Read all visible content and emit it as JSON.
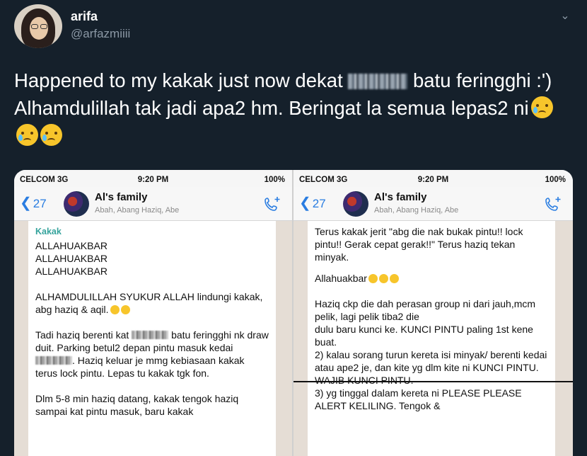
{
  "tweet": {
    "name": "arifa",
    "handle": "@arfazmiiii",
    "text_1": "Happened to my kakak just now dekat ",
    "text_2": " batu feringghi :') Alhamdulillah tak jadi apa2 hm. Beringat la semua lepas2 ni",
    "emoji_count": 3,
    "emoji_icon": "crying-face-icon"
  },
  "phone": {
    "carrier": "CELCOM  3G",
    "time": "9:20 PM",
    "battery": "100%",
    "back_count": "27",
    "group_name": "Al's family",
    "members": "Abah, Abang Haziq, Abe"
  },
  "chat_left": {
    "sender": "Kakak",
    "l1": "ALLAHUAKBAR\nALLAHUAKBAR\nALLAHUAKBAR",
    "l2": "ALHAMDULILLAH SYUKUR ALLAH lindungi kakak, abg haziq & aqil.",
    "l3a": "Tadi haziq berenti kat ",
    "l3b": " batu feringghi nk draw duit. Parking betul2 depan pintu masuk kedai ",
    "l3c": ". Haziq keluar je mmg kebiasaan kakak terus lock pintu. Lepas tu kakak tgk fon.",
    "l4": "Dlm 5-8 min haziq datang, kakak tengok haziq sampai kat pintu masuk, baru kakak"
  },
  "chat_right": {
    "l1": "Terus kakak jerit \"abg die nak bukak pintu!! lock pintu!! Gerak cepat gerak!!\" Terus haziq tekan minyak.",
    "l2": "Allahuakbar",
    "l3": "Haziq ckp die dah perasan group ni dari jauh,mcm pelik, lagi pelik tiba2 die",
    "l4": "dulu baru kunci ke. KUNCI PINTU paling 1st kene buat.\n2) kalau sorang turun kereta isi minyak/ berenti kedai atau ape2 je, dan kite yg dlm kite ni KUNCI PINTU. WAJIB KUNCI PINTU.\n3) yg tinggal dalam kereta ni PLEASE PLEASE ALERT KELILING. Tengok &"
  }
}
